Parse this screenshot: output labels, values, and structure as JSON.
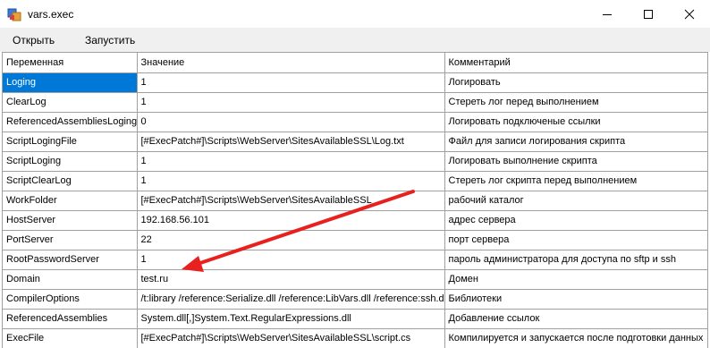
{
  "window": {
    "title": "vars.exec",
    "icon": "app-icon",
    "controls": [
      "minimize-icon",
      "maximize-icon",
      "close-icon"
    ]
  },
  "menu": {
    "items": [
      {
        "label": "Открыть"
      },
      {
        "label": "Запустить"
      }
    ]
  },
  "grid": {
    "columns": [
      "Переменная",
      "Значение",
      "Комментарий"
    ],
    "rows": [
      {
        "name": "Loging",
        "value": "1",
        "comment": "Логировать",
        "selected": true
      },
      {
        "name": "ClearLog",
        "value": "1",
        "comment": "Стереть лог перед выполнением"
      },
      {
        "name": "ReferencedAssembliesLoging",
        "value": "0",
        "comment": "Логировать подключеные ссылки"
      },
      {
        "name": "ScriptLogingFile",
        "value": "[#ExecPatch#]\\Scripts\\WebServer\\SitesAvailableSSL\\Log.txt",
        "comment": "Файл для записи логирования скрипта"
      },
      {
        "name": "ScriptLoging",
        "value": "1",
        "comment": "Логировать выполнение скрипта"
      },
      {
        "name": "ScriptClearLog",
        "value": "1",
        "comment": "Стереть лог скрипта перед выполнением"
      },
      {
        "name": "WorkFolder",
        "value": "[#ExecPatch#]\\Scripts\\WebServer\\SitesAvailableSSL",
        "comment": "рабочий каталог"
      },
      {
        "name": "HostServer",
        "value": "192.168.56.101",
        "comment": "адрес сервера"
      },
      {
        "name": "PortServer",
        "value": "22",
        "comment": "порт сервера"
      },
      {
        "name": "RootPasswordServer",
        "value": "1",
        "comment": "пароль администратора для доступа по sftp и ssh"
      },
      {
        "name": "Domain",
        "value": "test.ru",
        "comment": "Домен"
      },
      {
        "name": "CompilerOptions",
        "value": "/t:library /reference:Serialize.dll /reference:LibVars.dll /reference:ssh.dll",
        "comment": "Библиотеки"
      },
      {
        "name": "ReferencedAssemblies",
        "value": "System.dll[,]System.Text.RegularExpressions.dll",
        "comment": "Добавление ссылок"
      },
      {
        "name": "ExecFile",
        "value": "[#ExecPatch#]\\Scripts\\WebServer\\SitesAvailableSSL\\script.cs",
        "comment": "Компилируется и запускается после подготовки данных"
      }
    ]
  },
  "colors": {
    "selection": "#0078d7",
    "menubar": "#f0f0f0",
    "gridline": "#a0a0a0",
    "arrow": "#e8201e"
  }
}
